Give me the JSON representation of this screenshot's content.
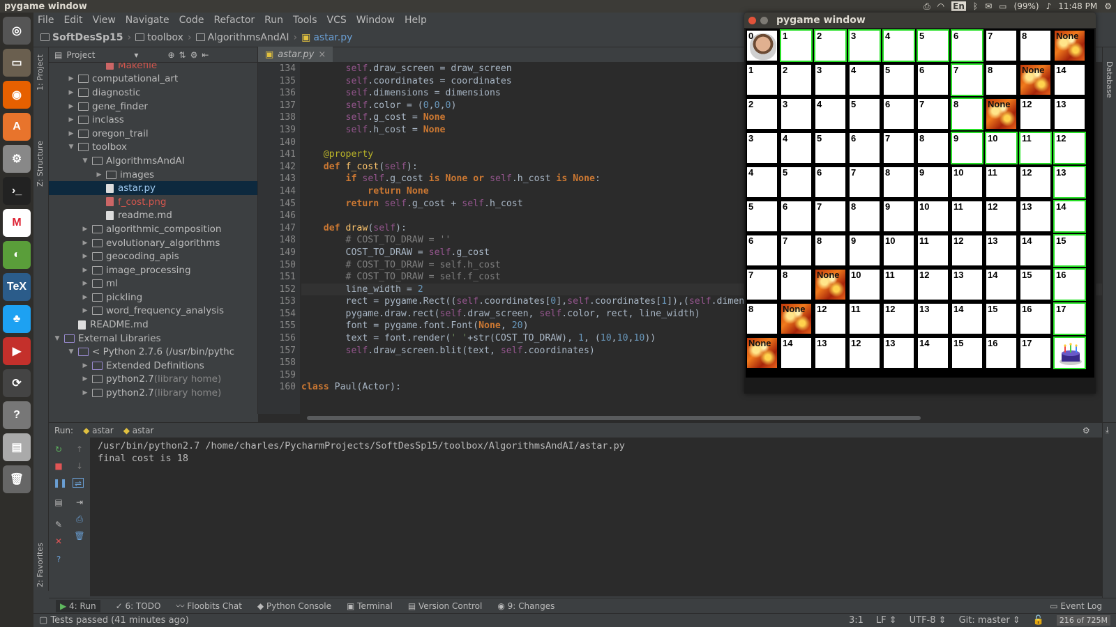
{
  "system_bar": {
    "window_title": "pygame window",
    "keyboard": "En",
    "battery": "(99%)",
    "time": "11:48 PM"
  },
  "launcher": [
    "dash-icon",
    "files-icon",
    "firefox-icon",
    "software-center-icon",
    "settings-icon",
    "terminal-icon",
    "gmail-icon",
    "browser-icon",
    "tex-icon",
    "twitter-icon",
    "youtube-icon",
    "updater-icon",
    "help-icon",
    "drive-icon",
    "trash-icon"
  ],
  "menu": [
    "File",
    "Edit",
    "View",
    "Navigate",
    "Code",
    "Refactor",
    "Run",
    "Tools",
    "VCS",
    "Window",
    "Help"
  ],
  "breadcrumb": [
    "SoftDesSp15",
    "toolbox",
    "AlgorithmsAndAI",
    "astar.py"
  ],
  "left_tabs": {
    "project": "1: Project",
    "structure": "Z: Structure",
    "favorites": "2: Favorites"
  },
  "right_tabs": {
    "database": "Database"
  },
  "project_panel": {
    "header": "Project"
  },
  "tree": [
    {
      "label": "Makefile",
      "depth": 3,
      "kind": "file-red",
      "arrow": ""
    },
    {
      "label": "computational_art",
      "depth": 1,
      "kind": "folder",
      "arrow": "▶"
    },
    {
      "label": "diagnostic",
      "depth": 1,
      "kind": "folder",
      "arrow": "▶"
    },
    {
      "label": "gene_finder",
      "depth": 1,
      "kind": "folder",
      "arrow": "▶"
    },
    {
      "label": "inclass",
      "depth": 1,
      "kind": "folder",
      "arrow": "▶"
    },
    {
      "label": "oregon_trail",
      "depth": 1,
      "kind": "folder",
      "arrow": "▶"
    },
    {
      "label": "toolbox",
      "depth": 1,
      "kind": "folder",
      "arrow": "▼"
    },
    {
      "label": "AlgorithmsAndAI",
      "depth": 2,
      "kind": "folder",
      "arrow": "▼"
    },
    {
      "label": "images",
      "depth": 3,
      "kind": "folder",
      "arrow": "▶"
    },
    {
      "label": "astar.py",
      "depth": 3,
      "kind": "file",
      "arrow": "",
      "selected": true
    },
    {
      "label": "f_cost.png",
      "depth": 3,
      "kind": "file-red",
      "arrow": ""
    },
    {
      "label": "readme.md",
      "depth": 3,
      "kind": "file",
      "arrow": ""
    },
    {
      "label": "algorithmic_composition",
      "depth": 2,
      "kind": "folder",
      "arrow": "▶"
    },
    {
      "label": "evolutionary_algorithms",
      "depth": 2,
      "kind": "folder",
      "arrow": "▶"
    },
    {
      "label": "geocoding_apis",
      "depth": 2,
      "kind": "folder",
      "arrow": "▶"
    },
    {
      "label": "image_processing",
      "depth": 2,
      "kind": "folder",
      "arrow": "▶"
    },
    {
      "label": "ml",
      "depth": 2,
      "kind": "folder",
      "arrow": "▶"
    },
    {
      "label": "pickling",
      "depth": 2,
      "kind": "folder",
      "arrow": "▶"
    },
    {
      "label": "word_frequency_analysis",
      "depth": 2,
      "kind": "folder",
      "arrow": "▶"
    },
    {
      "label": "README.md",
      "depth": 1,
      "kind": "file",
      "arrow": ""
    },
    {
      "label": "External Libraries",
      "depth": 0,
      "kind": "lib",
      "arrow": "▼"
    },
    {
      "label": "< Python 2.7.6 (/usr/bin/pythc",
      "depth": 1,
      "kind": "lib",
      "arrow": "▼"
    },
    {
      "label": "Extended Definitions",
      "depth": 2,
      "kind": "lib",
      "arrow": "▶"
    },
    {
      "label": "python2.7",
      "suffix": " (library home)",
      "depth": 2,
      "kind": "folder",
      "arrow": "▶"
    },
    {
      "label": "python2.7",
      "suffix": " (library home)",
      "depth": 2,
      "kind": "folder",
      "arrow": "▶"
    }
  ],
  "editor": {
    "tab": "astar.py",
    "lines": [
      {
        "n": "134",
        "t": "        self.draw_screen = draw_screen"
      },
      {
        "n": "135",
        "t": "        self.coordinates = coordinates"
      },
      {
        "n": "136",
        "t": "        self.dimensions = dimensions"
      },
      {
        "n": "137",
        "t": "        self.color = (0,0,0)"
      },
      {
        "n": "138",
        "t": "        self.g_cost = None"
      },
      {
        "n": "139",
        "t": "        self.h_cost = None"
      },
      {
        "n": "140",
        "t": ""
      },
      {
        "n": "141",
        "t": "    @property"
      },
      {
        "n": "142",
        "t": "    def f_cost(self):"
      },
      {
        "n": "143",
        "t": "        if self.g_cost is None or self.h_cost is None:"
      },
      {
        "n": "144",
        "t": "            return None"
      },
      {
        "n": "145",
        "t": "        return self.g_cost + self.h_cost"
      },
      {
        "n": "146",
        "t": ""
      },
      {
        "n": "147",
        "t": "    def draw(self):"
      },
      {
        "n": "148",
        "t": "        # COST_TO_DRAW = ''"
      },
      {
        "n": "149",
        "t": "        COST_TO_DRAW = self.g_cost"
      },
      {
        "n": "150",
        "t": "        # COST_TO_DRAW = self.h_cost"
      },
      {
        "n": "151",
        "t": "        # COST_TO_DRAW = self.f_cost"
      },
      {
        "n": "152",
        "t": "        line_width = 2"
      },
      {
        "n": "153",
        "t": "        rect = pygame.Rect((self.coordinates[0],self.coordinates[1]),(self.dimensions"
      },
      {
        "n": "154",
        "t": "        pygame.draw.rect(self.draw_screen, self.color, rect, line_width)"
      },
      {
        "n": "155",
        "t": "        font = pygame.font.Font(None, 20)"
      },
      {
        "n": "156",
        "t": "        text = font.render(' '+str(COST_TO_DRAW), 1, (10,10,10))"
      },
      {
        "n": "157",
        "t": "        self.draw_screen.blit(text, self.coordinates)"
      },
      {
        "n": "158",
        "t": ""
      },
      {
        "n": "159",
        "t": ""
      },
      {
        "n": "160",
        "t": "class Paul(Actor):"
      }
    ]
  },
  "run": {
    "label": "Run:",
    "tabs": [
      "astar",
      "astar"
    ],
    "console": [
      "/usr/bin/python2.7 /home/charles/PycharmProjects/SoftDesSp15/toolbox/AlgorithmsAndAI/astar.py",
      "final cost is 18"
    ]
  },
  "bottom_tabs": [
    "4: Run",
    "6: TODO",
    "Floobits Chat",
    "Python Console",
    "Terminal",
    "Version Control",
    "9: Changes"
  ],
  "event_log": "Event Log",
  "status": {
    "message": "Tests passed (41 minutes ago)",
    "position": "3:1",
    "line_sep": "LF",
    "encoding": "UTF-8",
    "vcs": "Git: master",
    "memory": "216 of 725M"
  },
  "pygame": {
    "title": "pygame window",
    "rows": [
      [
        "0",
        "1",
        "2",
        "3",
        "4",
        "5",
        "6",
        "7",
        "8",
        "None"
      ],
      [
        "1",
        "2",
        "3",
        "4",
        "5",
        "6",
        "7",
        "8",
        "None",
        "14"
      ],
      [
        "2",
        "3",
        "4",
        "5",
        "6",
        "7",
        "8",
        "None",
        "12",
        "13"
      ],
      [
        "3",
        "4",
        "5",
        "6",
        "7",
        "8",
        "9",
        "10",
        "11",
        "12"
      ],
      [
        "4",
        "5",
        "6",
        "7",
        "8",
        "9",
        "10",
        "11",
        "12",
        "13"
      ],
      [
        "5",
        "6",
        "7",
        "8",
        "9",
        "10",
        "11",
        "12",
        "13",
        "14"
      ],
      [
        "6",
        "7",
        "8",
        "9",
        "10",
        "11",
        "12",
        "13",
        "14",
        "15"
      ],
      [
        "7",
        "8",
        "None",
        "10",
        "11",
        "12",
        "13",
        "14",
        "15",
        "16"
      ],
      [
        "8",
        "None",
        "12",
        "11",
        "12",
        "13",
        "14",
        "15",
        "16",
        "17"
      ],
      [
        "None",
        "14",
        "13",
        "12",
        "13",
        "14",
        "15",
        "16",
        "17",
        ""
      ]
    ],
    "path_cells": [
      [
        0,
        1
      ],
      [
        0,
        2
      ],
      [
        0,
        3
      ],
      [
        0,
        4
      ],
      [
        0,
        5
      ],
      [
        0,
        6
      ],
      [
        1,
        6
      ],
      [
        2,
        6
      ],
      [
        3,
        6
      ],
      [
        3,
        7
      ],
      [
        3,
        8
      ],
      [
        3,
        9
      ],
      [
        4,
        9
      ],
      [
        5,
        9
      ],
      [
        6,
        9
      ],
      [
        7,
        9
      ],
      [
        8,
        9
      ],
      [
        9,
        9
      ]
    ],
    "start": [
      0,
      0
    ],
    "goal": [
      9,
      9
    ]
  }
}
